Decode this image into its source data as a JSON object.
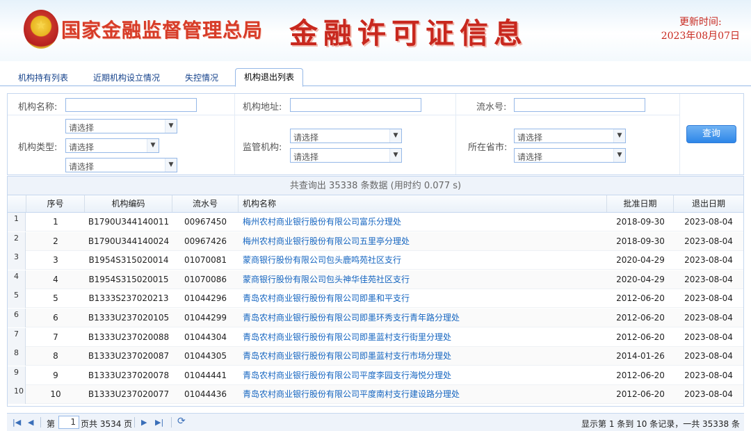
{
  "header": {
    "agency": "国家金融监督管理总局",
    "title": "金融许可证信息",
    "update_label": "更新时间:",
    "update_date": "2023年08月07日"
  },
  "tabs": [
    {
      "label": "机构持有列表"
    },
    {
      "label": "近期机构设立情况"
    },
    {
      "label": "失控情况"
    },
    {
      "label": "机构退出列表",
      "active": true
    }
  ],
  "search": {
    "name_label": "机构名称:",
    "address_label": "机构地址:",
    "serial_label": "流水号:",
    "type_label": "机构类型:",
    "supervisor_label": "监管机构:",
    "province_label": "所在省市:",
    "select_placeholder": "请选择",
    "query_button": "查询"
  },
  "summary": "共查询出 35338 条数据 (用时约 0.077 s)",
  "columns": [
    "序号",
    "机构编码",
    "流水号",
    "机构名称",
    "批准日期",
    "退出日期"
  ],
  "rows": [
    {
      "rn": "1",
      "seq": "1",
      "code": "B1790U344140011",
      "serial": "00967450",
      "name": "梅州农村商业银行股份有限公司富乐分理处",
      "approve": "2018-09-30",
      "exit": "2023-08-04"
    },
    {
      "rn": "2",
      "seq": "2",
      "code": "B1790U344140024",
      "serial": "00967426",
      "name": "梅州农村商业银行股份有限公司五里亭分理处",
      "approve": "2018-09-30",
      "exit": "2023-08-04"
    },
    {
      "rn": "3",
      "seq": "3",
      "code": "B1954S315020014",
      "serial": "01070081",
      "name": "蒙商银行股份有限公司包头鹿鸣苑社区支行",
      "approve": "2020-04-29",
      "exit": "2023-08-04"
    },
    {
      "rn": "4",
      "seq": "4",
      "code": "B1954S315020015",
      "serial": "01070086",
      "name": "蒙商银行股份有限公司包头神华佳苑社区支行",
      "approve": "2020-04-29",
      "exit": "2023-08-04"
    },
    {
      "rn": "5",
      "seq": "5",
      "code": "B1333S237020213",
      "serial": "01044296",
      "name": "青岛农村商业银行股份有限公司即墨和平支行",
      "approve": "2012-06-20",
      "exit": "2023-08-04"
    },
    {
      "rn": "6",
      "seq": "6",
      "code": "B1333U237020105",
      "serial": "01044299",
      "name": "青岛农村商业银行股份有限公司即墨环秀支行青年路分理处",
      "approve": "2012-06-20",
      "exit": "2023-08-04"
    },
    {
      "rn": "7",
      "seq": "7",
      "code": "B1333U237020088",
      "serial": "01044304",
      "name": "青岛农村商业银行股份有限公司即墨蓝村支行街里分理处",
      "approve": "2012-06-20",
      "exit": "2023-08-04"
    },
    {
      "rn": "8",
      "seq": "8",
      "code": "B1333U237020087",
      "serial": "01044305",
      "name": "青岛农村商业银行股份有限公司即墨蓝村支行市场分理处",
      "approve": "2014-01-26",
      "exit": "2023-08-04"
    },
    {
      "rn": "9",
      "seq": "9",
      "code": "B1333U237020078",
      "serial": "01044441",
      "name": "青岛农村商业银行股份有限公司平度李园支行海悦分理处",
      "approve": "2012-06-20",
      "exit": "2023-08-04"
    },
    {
      "rn": "10",
      "seq": "10",
      "code": "B1333U237020077",
      "serial": "01044436",
      "name": "青岛农村商业银行股份有限公司平度南村支行建设路分理处",
      "approve": "2012-06-20",
      "exit": "2023-08-04"
    }
  ],
  "pager": {
    "page_prefix": "第",
    "current_page": "1",
    "page_suffix": "页共 3534 页",
    "info": "显示第 1 条到 10 条记录，一共 35338 条"
  },
  "colors": {
    "accent": "#2d86e8",
    "title_red": "#c8281e",
    "link": "#1565c0"
  }
}
